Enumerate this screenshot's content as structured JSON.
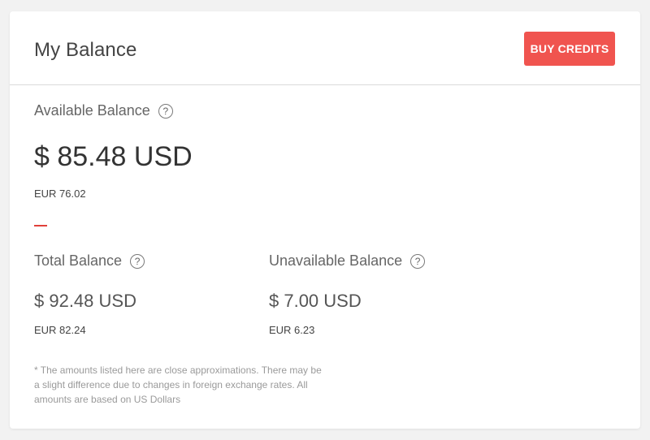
{
  "header": {
    "title": "My Balance",
    "buy_button_label": "BUY CREDITS"
  },
  "available": {
    "label": "Available Balance",
    "amount_usd": "$ 85.48 USD",
    "amount_eur": "EUR 76.02"
  },
  "total": {
    "label": "Total Balance",
    "amount_usd": "$ 92.48 USD",
    "amount_eur": "EUR 82.24"
  },
  "unavailable": {
    "label": "Unavailable Balance",
    "amount_usd": "$ 7.00 USD",
    "amount_eur": "EUR 6.23"
  },
  "help_icon_glyph": "?",
  "footnote": "* The amounts listed here are close approximations. There may be a slight difference due to changes in foreign exchange rates. All amounts are based on US Dollars",
  "colors": {
    "accent": "#f0544f"
  },
  "icons": [
    "help-icon"
  ]
}
